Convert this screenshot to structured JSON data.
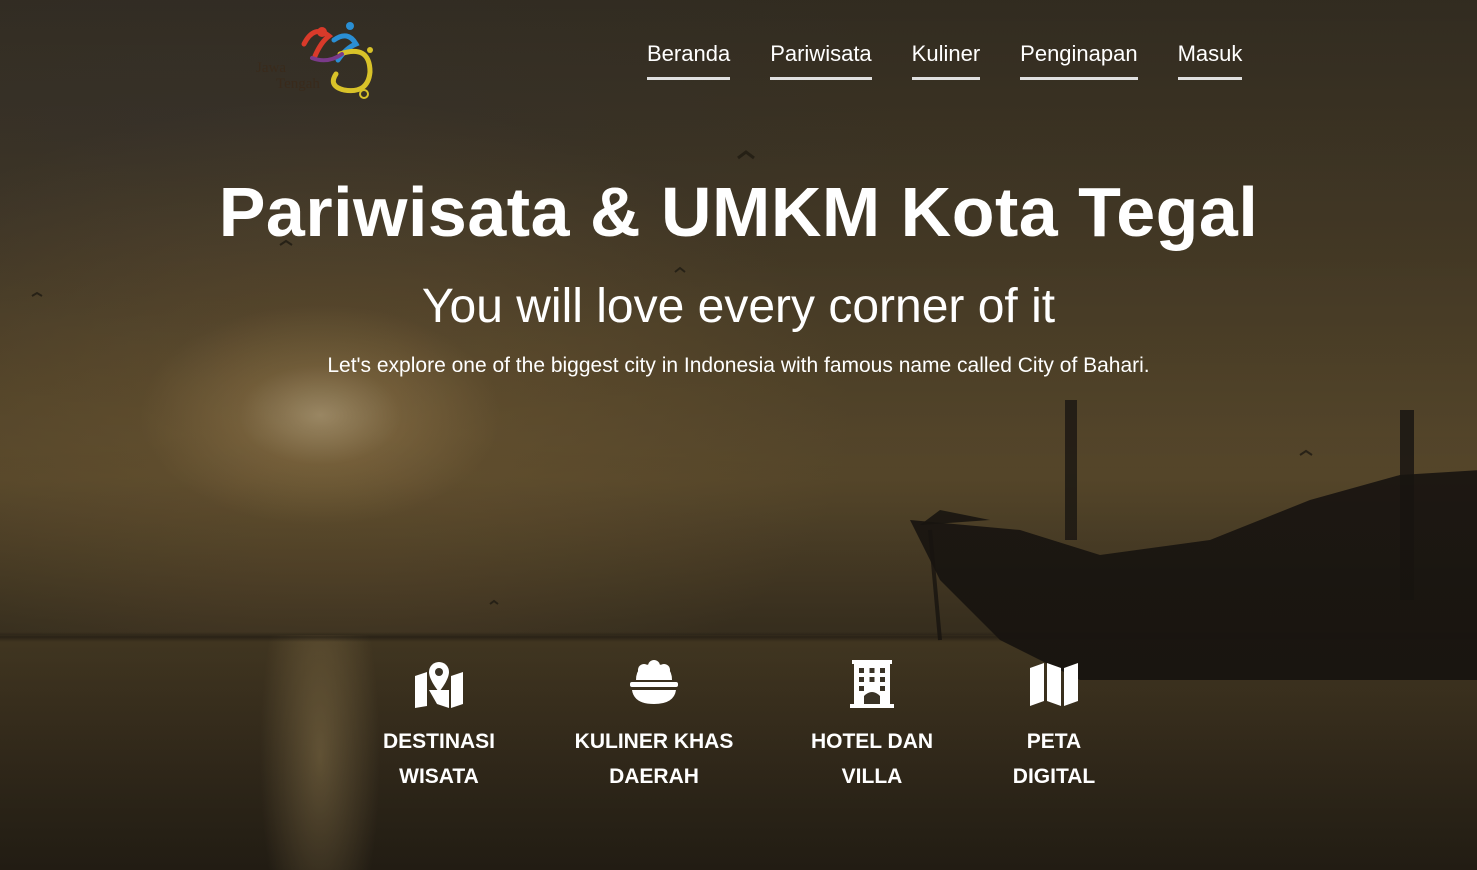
{
  "brand": {
    "logo_icon": "jawa-tengah-logo",
    "logo_text": "Jawa Tengah"
  },
  "nav": {
    "items": [
      {
        "label": "Beranda"
      },
      {
        "label": "Pariwisata"
      },
      {
        "label": "Kuliner"
      },
      {
        "label": "Penginapan"
      },
      {
        "label": "Masuk"
      }
    ]
  },
  "hero": {
    "title": "Pariwisata & UMKM Kota Tegal",
    "subtitle": "You will love every corner of it",
    "description": "Let's explore one of the biggest city in Indonesia with famous name called City of Bahari."
  },
  "features": [
    {
      "icon": "map-marker-icon",
      "label": "DESTINASI\nWISATA"
    },
    {
      "icon": "food-bowl-icon",
      "label": "KULINER KHAS\nDAERAH"
    },
    {
      "icon": "hotel-building-icon",
      "label": "HOTEL DAN\nVILLA"
    },
    {
      "icon": "folded-map-icon",
      "label": "PETA\nDIGITAL"
    }
  ],
  "colors": {
    "text": "#ffffff",
    "nav_underline": "#e0e0e0",
    "background": "#3a3326"
  }
}
